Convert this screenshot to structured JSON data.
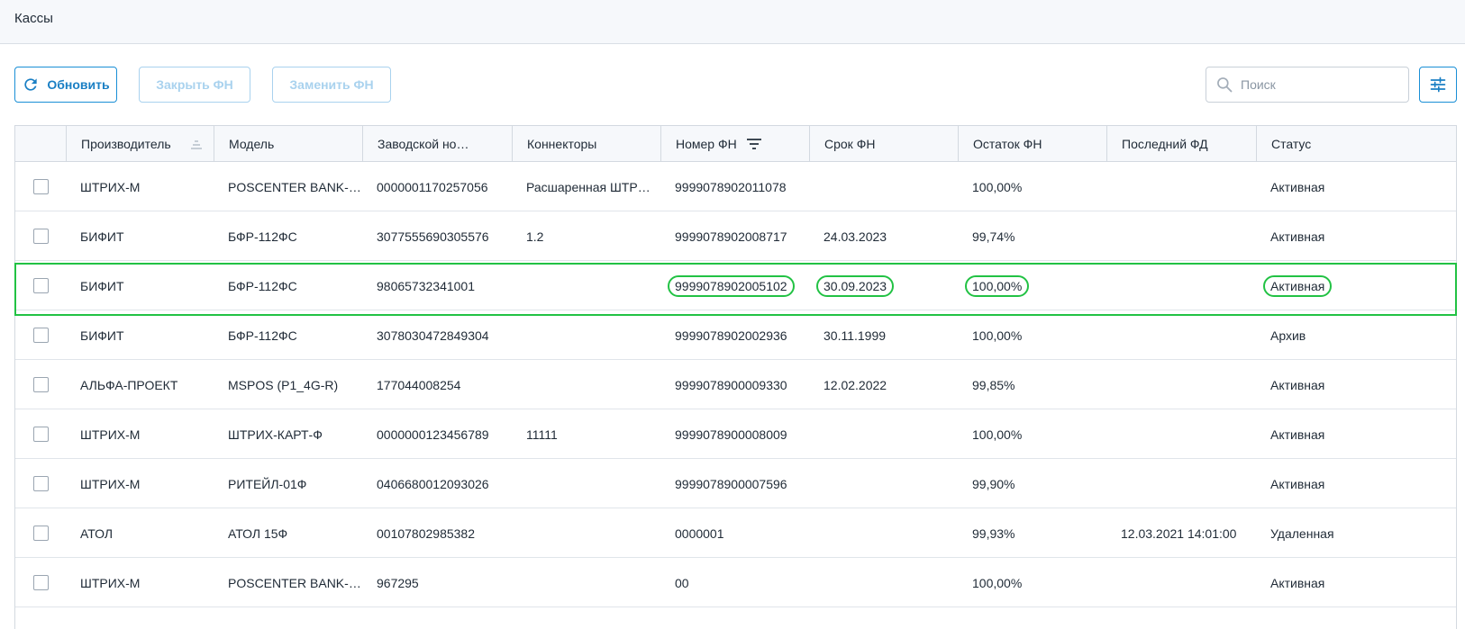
{
  "header": {
    "title": "Кассы"
  },
  "toolbar": {
    "refresh_label": "Обновить",
    "close_fn_label": "Закрыть ФН",
    "replace_fn_label": "Заменить ФН",
    "search_placeholder": "Поиск"
  },
  "colors": {
    "accent": "#1a8fd6",
    "highlight": "#22c244",
    "disabled": "#a9d2ee"
  },
  "table": {
    "columns": [
      "Производитель",
      "Модель",
      "Заводской но…",
      "Коннекторы",
      "Номер ФН",
      "Срок ФН",
      "Остаток ФН",
      "Последний ФД",
      "Статус"
    ],
    "rows": [
      [
        "ШТРИХ-М",
        "POSCENTER BANK-0…",
        "0000001170257056",
        "Расшаренная ШТР…",
        "9999078902011078",
        "",
        "100,00%",
        "",
        "Активная"
      ],
      [
        "БИФИТ",
        "БФР-112ФС",
        "3077555690305576",
        "1.2",
        "9999078902008717",
        "24.03.2023",
        "99,74%",
        "",
        "Активная"
      ],
      [
        "БИФИТ",
        "БФР-112ФС",
        "98065732341001",
        "",
        "9999078902005102",
        "30.09.2023",
        "100,00%",
        "",
        "Активная"
      ],
      [
        "БИФИТ",
        "БФР-112ФС",
        "3078030472849304",
        "",
        "9999078902002936",
        "30.11.1999",
        "100,00%",
        "",
        "Архив"
      ],
      [
        "АЛЬФА-ПРОЕКТ",
        "MSPOS (P1_4G-R)",
        "177044008254",
        "",
        "9999078900009330",
        "12.02.2022",
        "99,85%",
        "",
        "Активная"
      ],
      [
        "ШТРИХ-М",
        "ШТРИХ-КАРТ-Ф",
        "0000000123456789",
        "11111",
        "9999078900008009",
        "",
        "100,00%",
        "",
        "Активная"
      ],
      [
        "ШТРИХ-М",
        "РИТЕЙЛ-01Ф",
        "0406680012093026",
        "",
        "9999078900007596",
        "",
        "99,90%",
        "",
        "Активная"
      ],
      [
        "АТОЛ",
        "АТОЛ 15Ф",
        "00107802985382",
        "",
        "0000001",
        "",
        "99,93%",
        "12.03.2021 14:01:00",
        "Удаленная"
      ],
      [
        "ШТРИХ-М",
        "POSCENTER BANK-0…",
        "967295",
        "",
        "00",
        "",
        "100,00%",
        "",
        "Активная"
      ]
    ]
  }
}
